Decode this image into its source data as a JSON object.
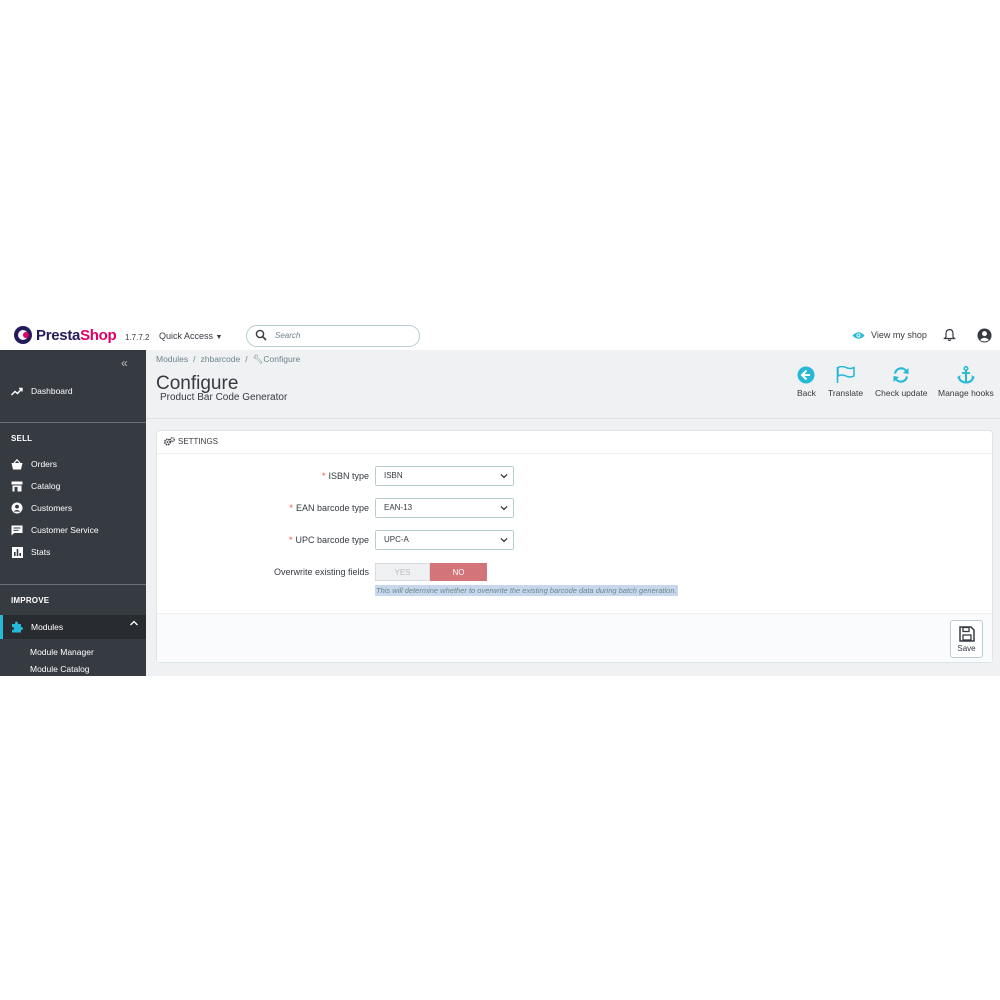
{
  "header": {
    "logo_presta": "Presta",
    "logo_shop": "Shop",
    "version": "1.7.7.2",
    "quick_access": "Quick Access",
    "search_placeholder": "Search",
    "view_shop": "View my shop"
  },
  "sidebar": {
    "dashboard": "Dashboard",
    "sell_label": "SELL",
    "sell_items": [
      "Orders",
      "Catalog",
      "Customers",
      "Customer Service",
      "Stats"
    ],
    "improve_label": "IMPROVE",
    "modules": "Modules",
    "module_sub": [
      "Module Manager",
      "Module Catalog"
    ]
  },
  "breadcrumb": [
    "Modules",
    "zhbarcode",
    "Configure"
  ],
  "page": {
    "title": "Configure",
    "subtitle": "Product Bar Code Generator"
  },
  "toolbar": {
    "back": "Back",
    "translate": "Translate",
    "check_update": "Check update",
    "manage_hooks": "Manage hooks"
  },
  "settings": {
    "heading": "SETTINGS",
    "isbn_label": "ISBN type",
    "isbn_value": "ISBN",
    "ean_label": "EAN barcode type",
    "ean_value": "EAN-13",
    "upc_label": "UPC barcode type",
    "upc_value": "UPC-A",
    "overwrite_label": "Overwrite existing fields",
    "yes": "YES",
    "no": "NO",
    "help": "This will determine whether to overwrite the existing barcode data during batch generation.",
    "save": "Save"
  },
  "colors": {
    "accent": "#25b9d7",
    "sidebar_bg": "#363a41",
    "toggle_no": "#d37479",
    "required": "#f54c3e"
  }
}
